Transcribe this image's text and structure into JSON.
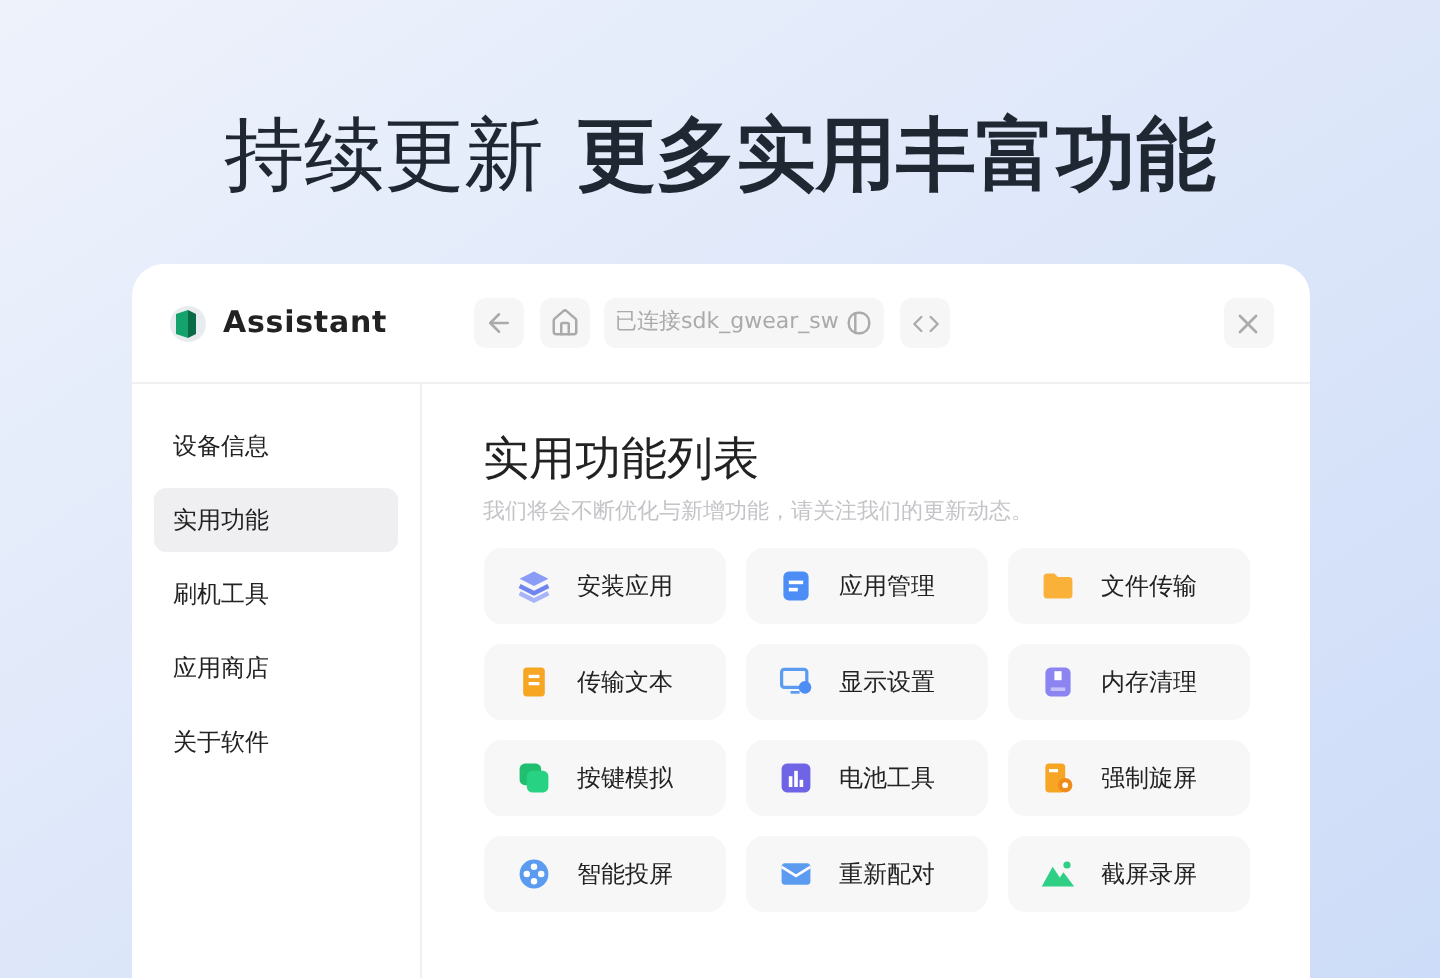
{
  "headline": {
    "regular": "持续更新",
    "bold": "更多实用丰富功能"
  },
  "app": {
    "name": "Assistant",
    "connection": "已连接sdk_gwear_sw"
  },
  "sidebar": {
    "items": [
      {
        "label": "设备信息",
        "selected": false
      },
      {
        "label": "实用功能",
        "selected": true
      },
      {
        "label": "刷机工具",
        "selected": false
      },
      {
        "label": "应用商店",
        "selected": false
      },
      {
        "label": "关于软件",
        "selected": false
      }
    ]
  },
  "content": {
    "title": "实用功能列表",
    "subtitle": "我们将会不断优化与新增功能，请关注我们的更新动态。",
    "features": [
      {
        "label": "安装应用"
      },
      {
        "label": "应用管理"
      },
      {
        "label": "文件传输"
      },
      {
        "label": "传输文本"
      },
      {
        "label": "显示设置"
      },
      {
        "label": "内存清理"
      },
      {
        "label": "按键模拟"
      },
      {
        "label": "电池工具"
      },
      {
        "label": "强制旋屏"
      },
      {
        "label": "智能投屏"
      },
      {
        "label": "重新配对"
      },
      {
        "label": "截屏录屏"
      }
    ]
  }
}
